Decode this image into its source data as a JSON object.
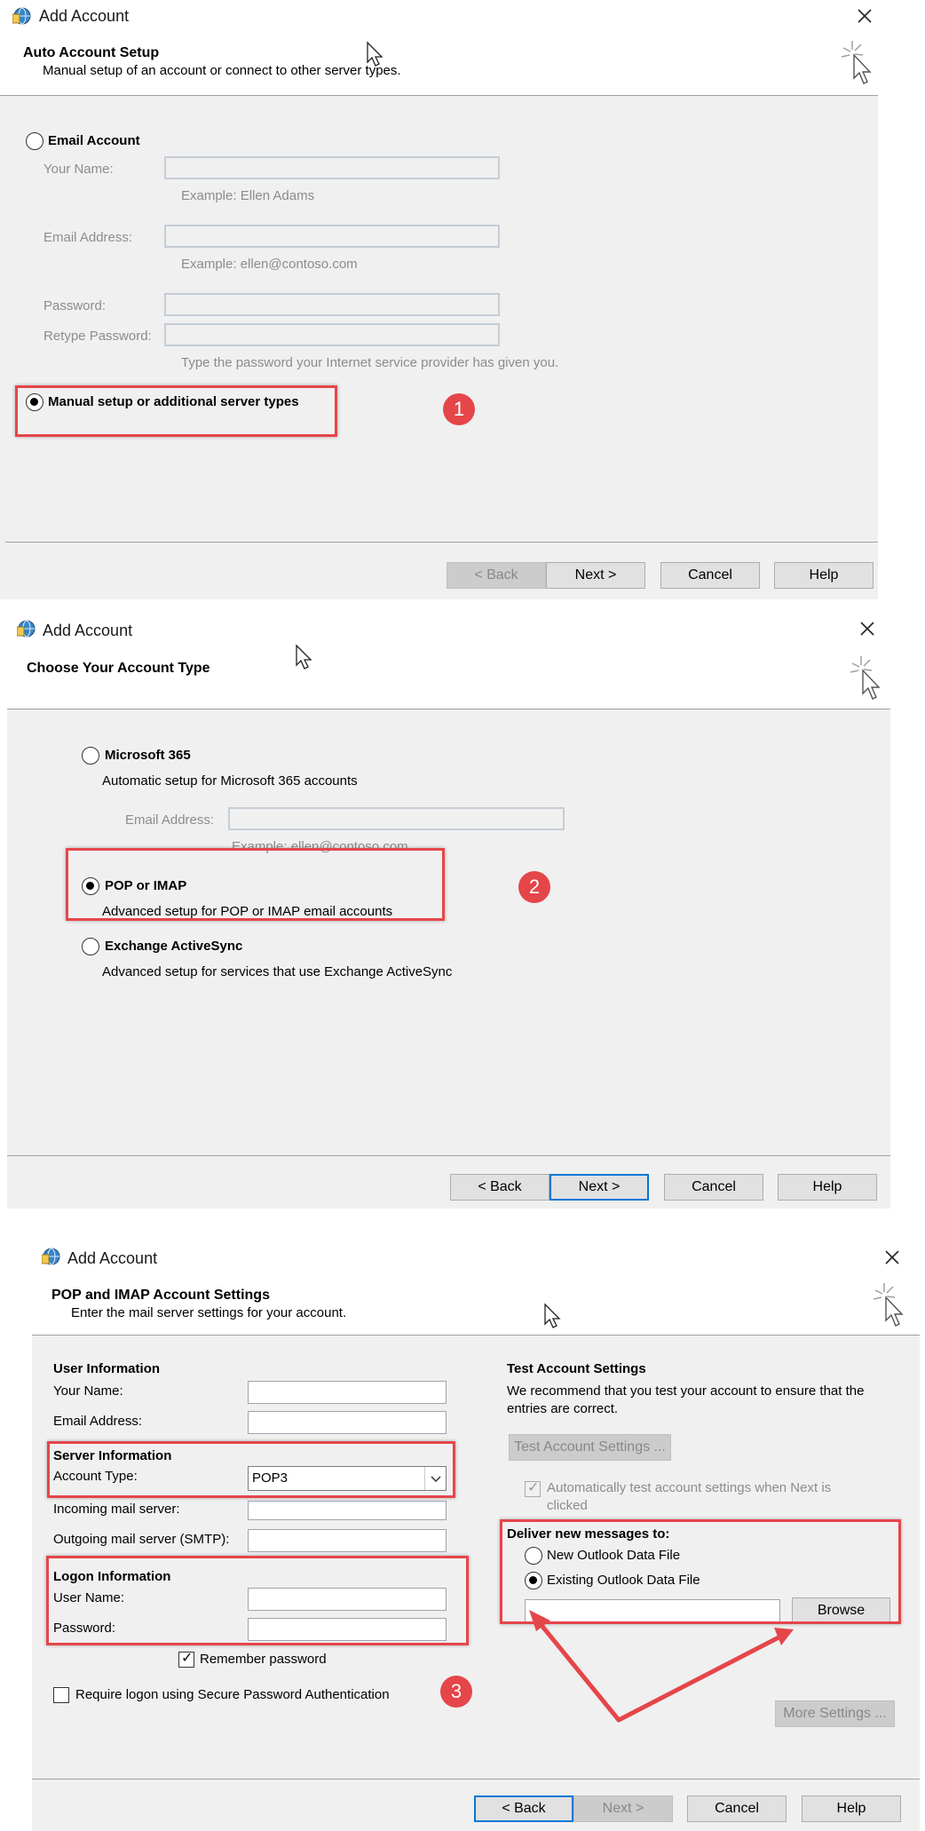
{
  "window_title": "Add Account",
  "step1": {
    "header_title": "Auto Account Setup",
    "header_subtitle": "Manual setup of an account or connect to other server types.",
    "email_account_label": "Email Account",
    "your_name_label": "Your Name:",
    "your_name_hint": "Example: Ellen Adams",
    "email_address_label": "Email Address:",
    "email_address_hint": "Example: ellen@contoso.com",
    "password_label": "Password:",
    "retype_password_label": "Retype Password:",
    "password_hint": "Type the password your Internet service provider has given you.",
    "manual_setup_label": "Manual setup or additional server types",
    "badge": "1",
    "buttons": {
      "back": "< Back",
      "next": "Next >",
      "cancel": "Cancel",
      "help": "Help"
    }
  },
  "step2": {
    "header_title": "Choose Your Account Type",
    "m365_label": "Microsoft 365",
    "m365_desc": "Automatic setup for Microsoft 365 accounts",
    "email_address_label": "Email Address:",
    "email_address_hint": "Example: ellen@contoso.com",
    "pop_imap_label": "POP or IMAP",
    "pop_imap_desc": "Advanced setup for POP or IMAP email accounts",
    "eas_label": "Exchange ActiveSync",
    "eas_desc": "Advanced setup for services that use Exchange ActiveSync",
    "badge": "2",
    "buttons": {
      "back": "< Back",
      "next": "Next >",
      "cancel": "Cancel",
      "help": "Help"
    }
  },
  "step3": {
    "header_title": "POP and IMAP Account Settings",
    "header_subtitle": "Enter the mail server settings for your account.",
    "user_info_heading": "User Information",
    "your_name_label": "Your Name:",
    "email_address_label": "Email Address:",
    "server_info_heading": "Server Information",
    "account_type_label": "Account Type:",
    "account_type_value": "POP3",
    "incoming_label": "Incoming mail server:",
    "outgoing_label": "Outgoing mail server (SMTP):",
    "logon_info_heading": "Logon Information",
    "user_name_label": "User Name:",
    "password_label": "Password:",
    "remember_password_label": "Remember password",
    "spa_label": "Require logon using Secure Password Authentication",
    "test_heading": "Test Account Settings",
    "test_desc_line1": "We recommend that you test your account to ensure that the",
    "test_desc_line2": "entries are correct.",
    "test_button": "Test Account Settings ...",
    "auto_test_line1": "Automatically test account settings when Next is",
    "auto_test_line2": "clicked",
    "deliver_heading": "Deliver new messages to:",
    "new_data_file_label": "New Outlook Data File",
    "existing_data_file_label": "Existing Outlook Data File",
    "browse_button": "Browse",
    "more_settings_button": "More Settings ...",
    "badge": "3",
    "buttons": {
      "back": "< Back",
      "next": "Next >",
      "cancel": "Cancel",
      "help": "Help"
    }
  },
  "colors": {
    "annotation_red": "#e5464a",
    "default_button_blue": "#0078d7",
    "dialog_bg": "#f0f0f0"
  },
  "icons": [
    "outlook-globe-icon",
    "close-icon",
    "wizard-sparkle-icon",
    "mouse-cursor-icon",
    "radio-icon",
    "checkbox-icon",
    "dropdown-chevron-icon",
    "arrow-annotation-icon"
  ]
}
